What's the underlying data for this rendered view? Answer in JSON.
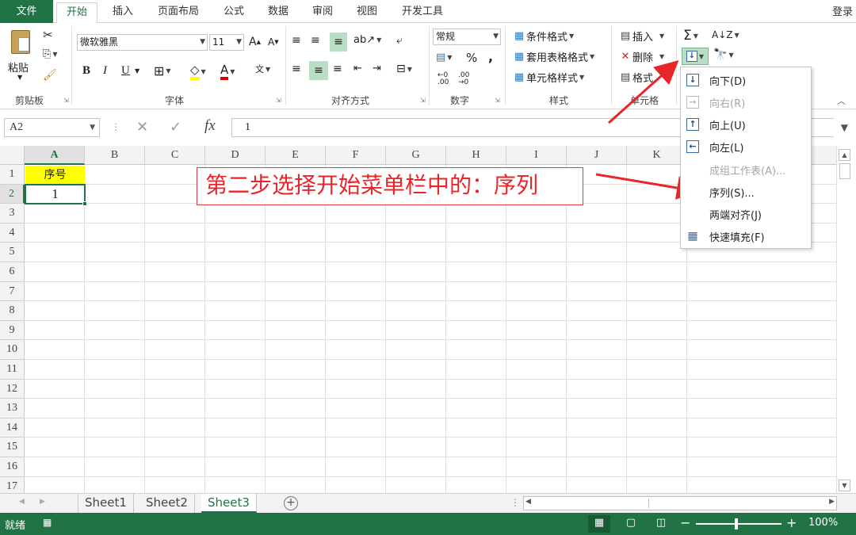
{
  "tabs": {
    "file": "文件",
    "home": "开始",
    "insert": "插入",
    "page_layout": "页面布局",
    "formulas": "公式",
    "data": "数据",
    "review": "审阅",
    "view": "视图",
    "developer": "开发工具",
    "login": "登录"
  },
  "ribbon": {
    "clipboard": {
      "paste": "粘贴",
      "label": "剪贴板"
    },
    "font": {
      "name": "微软雅黑",
      "size": "11",
      "bold": "B",
      "italic": "I",
      "underline": "U",
      "label": "字体"
    },
    "alignment": {
      "label": "对齐方式"
    },
    "number": {
      "format": "常规",
      "percent": "%",
      "comma": ",",
      "label": "数字"
    },
    "styles": {
      "conditional": "条件格式",
      "table": "套用表格格式",
      "cell_style": "单元格样式",
      "label": "样式"
    },
    "cells": {
      "insert": "插入",
      "delete": "删除",
      "format": "格式",
      "label": "单元格"
    }
  },
  "formula_bar": {
    "name_box": "A2",
    "fx": "fx",
    "value": "1"
  },
  "grid": {
    "columns": [
      "A",
      "B",
      "C",
      "D",
      "E",
      "F",
      "G",
      "H",
      "I",
      "J",
      "K"
    ],
    "rows": [
      "1",
      "2",
      "3",
      "4",
      "5",
      "6",
      "7",
      "8",
      "9",
      "10",
      "11",
      "12",
      "13",
      "14",
      "15",
      "16",
      "17"
    ],
    "a1": "序号",
    "a2": "1"
  },
  "annotation": "第二步选择开始菜单栏中的：序列",
  "fill_menu": {
    "down": "向下(D)",
    "right": "向右(R)",
    "up": "向上(U)",
    "left": "向左(L)",
    "group": "成组工作表(A)...",
    "series": "序列(S)...",
    "justify": "两端对齐(J)",
    "flash_fill": "快速填充(F)"
  },
  "sheets": [
    "Sheet1",
    "Sheet2",
    "Sheet3"
  ],
  "active_sheet": "Sheet3",
  "status": {
    "ready": "就绪",
    "zoom": "100%"
  },
  "colors": {
    "accent": "#217346",
    "highlight": "#ffff00",
    "annotation": "#e8262a"
  }
}
